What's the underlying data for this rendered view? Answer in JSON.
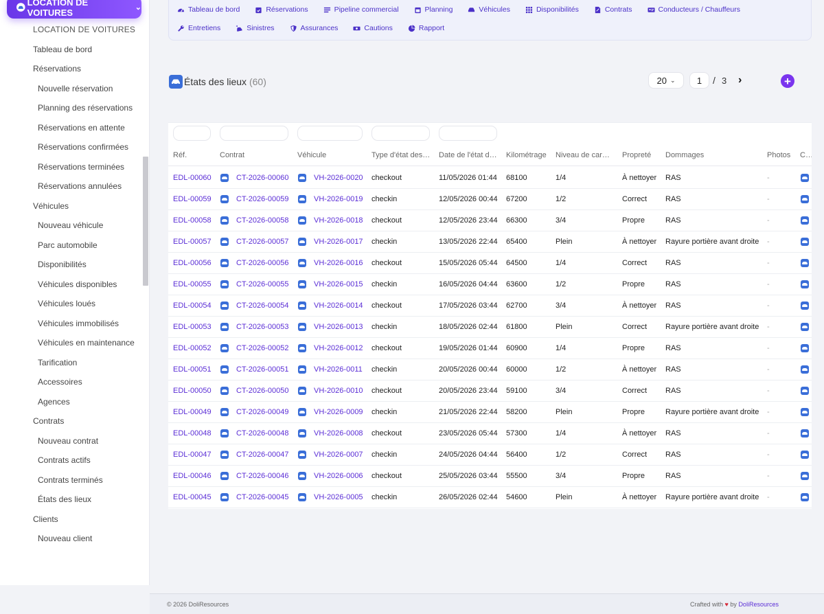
{
  "sidebar": {
    "brand_button": "LOCATION DE VOITURES",
    "items": [
      {
        "label": "LOCATION DE VOITURES",
        "level": 0
      },
      {
        "label": "Tableau de bord",
        "level": 0
      },
      {
        "label": "Réservations",
        "level": 0
      },
      {
        "label": "Nouvelle réservation",
        "level": 1
      },
      {
        "label": "Planning des réservations",
        "level": 1
      },
      {
        "label": "Réservations en attente",
        "level": 1
      },
      {
        "label": "Réservations confirmées",
        "level": 1
      },
      {
        "label": "Réservations terminées",
        "level": 1
      },
      {
        "label": "Réservations annulées",
        "level": 1
      },
      {
        "label": "Véhicules",
        "level": 0
      },
      {
        "label": "Nouveau véhicule",
        "level": 1
      },
      {
        "label": "Parc automobile",
        "level": 1
      },
      {
        "label": "Disponibilités",
        "level": 1
      },
      {
        "label": "Véhicules disponibles",
        "level": 1
      },
      {
        "label": "Véhicules loués",
        "level": 1
      },
      {
        "label": "Véhicules immobilisés",
        "level": 1
      },
      {
        "label": "Véhicules en maintenance",
        "level": 1
      },
      {
        "label": "Tarification",
        "level": 1
      },
      {
        "label": "Accessoires",
        "level": 1
      },
      {
        "label": "Agences",
        "level": 1
      },
      {
        "label": "Contrats",
        "level": 0
      },
      {
        "label": "Nouveau contrat",
        "level": 1
      },
      {
        "label": "Contrats actifs",
        "level": 1
      },
      {
        "label": "Contrats terminés",
        "level": 1
      },
      {
        "label": "États des lieux",
        "level": 1
      },
      {
        "label": "Clients",
        "level": 0
      },
      {
        "label": "Nouveau client",
        "level": 1
      }
    ]
  },
  "topnav": {
    "row1": [
      {
        "label": "Tableau de bord",
        "icon": "gauge-icon"
      },
      {
        "label": "Réservations",
        "icon": "calendar-check-icon"
      },
      {
        "label": "Pipeline commercial",
        "icon": "list-icon"
      },
      {
        "label": "Planning",
        "icon": "calendar-icon"
      },
      {
        "label": "Véhicules",
        "icon": "car-icon"
      },
      {
        "label": "Disponibilités",
        "icon": "grid-icon"
      },
      {
        "label": "Contrats",
        "icon": "file-signature-icon"
      },
      {
        "label": "Conducteurs / Chauffeurs",
        "icon": "id-card-icon"
      }
    ],
    "row2": [
      {
        "label": "Entretiens",
        "icon": "wrench-icon"
      },
      {
        "label": "Sinistres",
        "icon": "car-crash-icon"
      },
      {
        "label": "Assurances",
        "icon": "shield-icon"
      },
      {
        "label": "Cautions",
        "icon": "money-icon"
      },
      {
        "label": "Rapport",
        "icon": "pie-chart-icon"
      }
    ]
  },
  "header": {
    "title": "États des lieux",
    "count": "(60)"
  },
  "pagination": {
    "per_page": "20",
    "current_page": "1",
    "separator": "/",
    "total_pages": "3",
    "next": "›"
  },
  "add_button": "+",
  "table": {
    "columns": [
      "Réf.",
      "Contrat",
      "Véhicule",
      "Type d'état des lieux",
      "Date de l'état des lieux",
      "Kilométrage",
      "Niveau de carburant",
      "Propreté",
      "Dommages",
      "Photos",
      "Cha"
    ],
    "rows": [
      [
        "EDL-00060",
        "CT-2026-00060",
        "VH-2026-0020",
        "checkout",
        "11/05/2026 01:44",
        "68100",
        "1/4",
        "À nettoyer",
        "RAS",
        "-"
      ],
      [
        "EDL-00059",
        "CT-2026-00059",
        "VH-2026-0019",
        "checkin",
        "12/05/2026 00:44",
        "67200",
        "1/2",
        "Correct",
        "RAS",
        "-"
      ],
      [
        "EDL-00058",
        "CT-2026-00058",
        "VH-2026-0018",
        "checkout",
        "12/05/2026 23:44",
        "66300",
        "3/4",
        "Propre",
        "RAS",
        "-"
      ],
      [
        "EDL-00057",
        "CT-2026-00057",
        "VH-2026-0017",
        "checkin",
        "13/05/2026 22:44",
        "65400",
        "Plein",
        "À nettoyer",
        "Rayure portière avant droite",
        "-"
      ],
      [
        "EDL-00056",
        "CT-2026-00056",
        "VH-2026-0016",
        "checkout",
        "15/05/2026 05:44",
        "64500",
        "1/4",
        "Correct",
        "RAS",
        "-"
      ],
      [
        "EDL-00055",
        "CT-2026-00055",
        "VH-2026-0015",
        "checkin",
        "16/05/2026 04:44",
        "63600",
        "1/2",
        "Propre",
        "RAS",
        "-"
      ],
      [
        "EDL-00054",
        "CT-2026-00054",
        "VH-2026-0014",
        "checkout",
        "17/05/2026 03:44",
        "62700",
        "3/4",
        "À nettoyer",
        "RAS",
        "-"
      ],
      [
        "EDL-00053",
        "CT-2026-00053",
        "VH-2026-0013",
        "checkin",
        "18/05/2026 02:44",
        "61800",
        "Plein",
        "Correct",
        "Rayure portière avant droite",
        "-"
      ],
      [
        "EDL-00052",
        "CT-2026-00052",
        "VH-2026-0012",
        "checkout",
        "19/05/2026 01:44",
        "60900",
        "1/4",
        "Propre",
        "RAS",
        "-"
      ],
      [
        "EDL-00051",
        "CT-2026-00051",
        "VH-2026-0011",
        "checkin",
        "20/05/2026 00:44",
        "60000",
        "1/2",
        "À nettoyer",
        "RAS",
        "-"
      ],
      [
        "EDL-00050",
        "CT-2026-00050",
        "VH-2026-0010",
        "checkout",
        "20/05/2026 23:44",
        "59100",
        "3/4",
        "Correct",
        "RAS",
        "-"
      ],
      [
        "EDL-00049",
        "CT-2026-00049",
        "VH-2026-0009",
        "checkin",
        "21/05/2026 22:44",
        "58200",
        "Plein",
        "Propre",
        "Rayure portière avant droite",
        "-"
      ],
      [
        "EDL-00048",
        "CT-2026-00048",
        "VH-2026-0008",
        "checkout",
        "23/05/2026 05:44",
        "57300",
        "1/4",
        "À nettoyer",
        "RAS",
        "-"
      ],
      [
        "EDL-00047",
        "CT-2026-00047",
        "VH-2026-0007",
        "checkin",
        "24/05/2026 04:44",
        "56400",
        "1/2",
        "Correct",
        "RAS",
        "-"
      ],
      [
        "EDL-00046",
        "CT-2026-00046",
        "VH-2026-0006",
        "checkout",
        "25/05/2026 03:44",
        "55500",
        "3/4",
        "Propre",
        "RAS",
        "-"
      ],
      [
        "EDL-00045",
        "CT-2026-00045",
        "VH-2026-0005",
        "checkin",
        "26/05/2026 02:44",
        "54600",
        "Plein",
        "À nettoyer",
        "Rayure portière avant droite",
        "-"
      ]
    ]
  },
  "footer": {
    "copyright": "© 2026 DoliResources",
    "crafted": "Crafted with",
    "heart": "♥",
    "by": "by",
    "brand": "DoliResources"
  },
  "colors": {
    "accent": "#7a34ee",
    "link": "#5b2ed6",
    "icon_blue": "#3a6ed8"
  }
}
